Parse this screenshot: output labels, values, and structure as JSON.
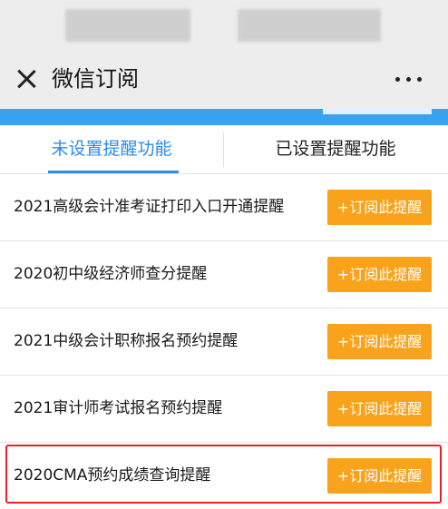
{
  "header": {
    "title": "微信订阅",
    "close_icon": "close-icon",
    "more_icon": "more-icon"
  },
  "tabs": [
    {
      "label": "未设置提醒功能",
      "active": true
    },
    {
      "label": "已设置提醒功能",
      "active": false
    }
  ],
  "button_label": "+订阅此提醒",
  "items": [
    {
      "label": "2021高级会计准考证打印入口开通提醒"
    },
    {
      "label": "2020初中级经济师查分提醒"
    },
    {
      "label": "2021中级会计职称报名预约提醒"
    },
    {
      "label": "2021审计师考试报名预约提醒"
    },
    {
      "label": "2020CMA预约成绩查询提醒",
      "highlighted": true
    }
  ],
  "colors": {
    "accent": "#2c8de8",
    "button": "#f9a21b",
    "highlight": "#e8202e",
    "band": "#3aa1ef"
  }
}
